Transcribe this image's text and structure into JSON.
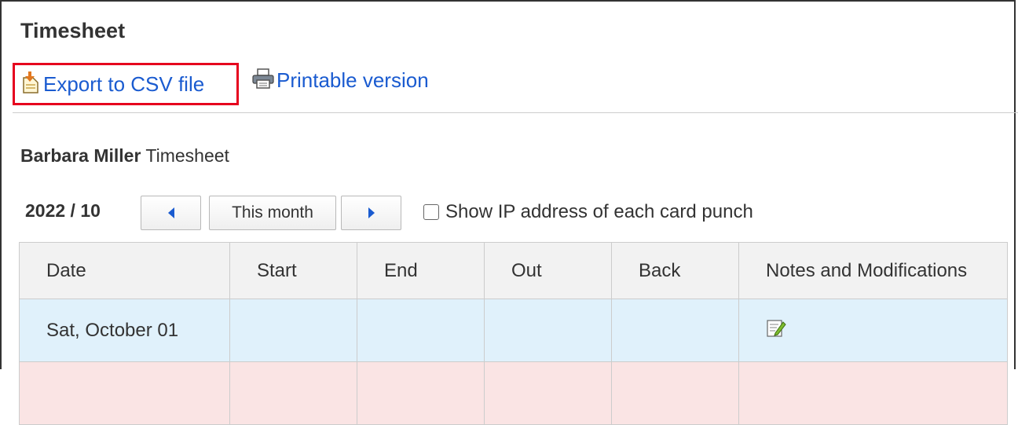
{
  "page": {
    "title": "Timesheet"
  },
  "actions": {
    "export_label": "Export to CSV file",
    "print_label": "Printable version"
  },
  "user": {
    "name": "Barbara Miller",
    "suffix": "Timesheet"
  },
  "nav": {
    "month": "2022 / 10",
    "this_month_label": "This month",
    "show_ip_label": "Show IP address of each card punch",
    "show_ip_checked": false
  },
  "table": {
    "headers": [
      "Date",
      "Start",
      "End",
      "Out",
      "Back",
      "Notes and Modifications"
    ],
    "rows": [
      {
        "date": "Sat, October 01",
        "start": "",
        "end": "",
        "out": "",
        "back": "",
        "notes_icon": "edit-note-icon"
      }
    ]
  },
  "colors": {
    "link": "#1a5bd0",
    "highlight_border": "#e6001e",
    "saturday_row": "#e0f1fb",
    "sunday_row": "#fae4e4",
    "header_bg": "#f2f2f2"
  }
}
